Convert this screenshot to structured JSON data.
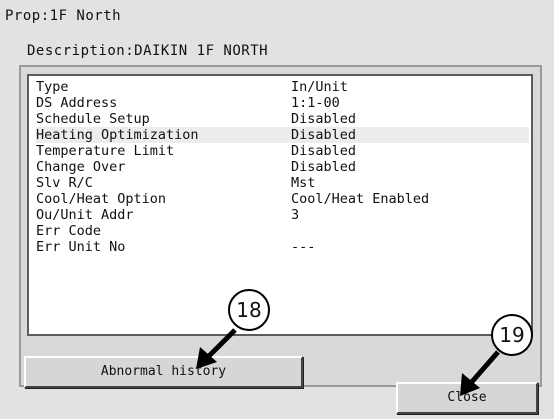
{
  "window": {
    "title": "Prop:1F North",
    "description": "Description:DAIKIN 1F NORTH"
  },
  "properties": [
    {
      "key": "Type",
      "value": "In/Unit"
    },
    {
      "key": "DS Address",
      "value": "1:1-00"
    },
    {
      "key": "Schedule Setup",
      "value": "Disabled"
    },
    {
      "key": "Heating Optimization",
      "value": "Disabled"
    },
    {
      "key": "Temperature Limit",
      "value": "Disabled"
    },
    {
      "key": "Change Over",
      "value": "Disabled"
    },
    {
      "key": "Slv R/C",
      "value": "Mst"
    },
    {
      "key": "Cool/Heat Option",
      "value": "Cool/Heat Enabled"
    },
    {
      "key": "Ou/Unit Addr",
      "value": "3"
    },
    {
      "key": "Err Code",
      "value": ""
    },
    {
      "key": "Err Unit No",
      "value": "---"
    }
  ],
  "buttons": {
    "abnormal_history": "Abnormal history",
    "close": "Close"
  },
  "callouts": {
    "abnormal_history": "18",
    "close": "19"
  }
}
